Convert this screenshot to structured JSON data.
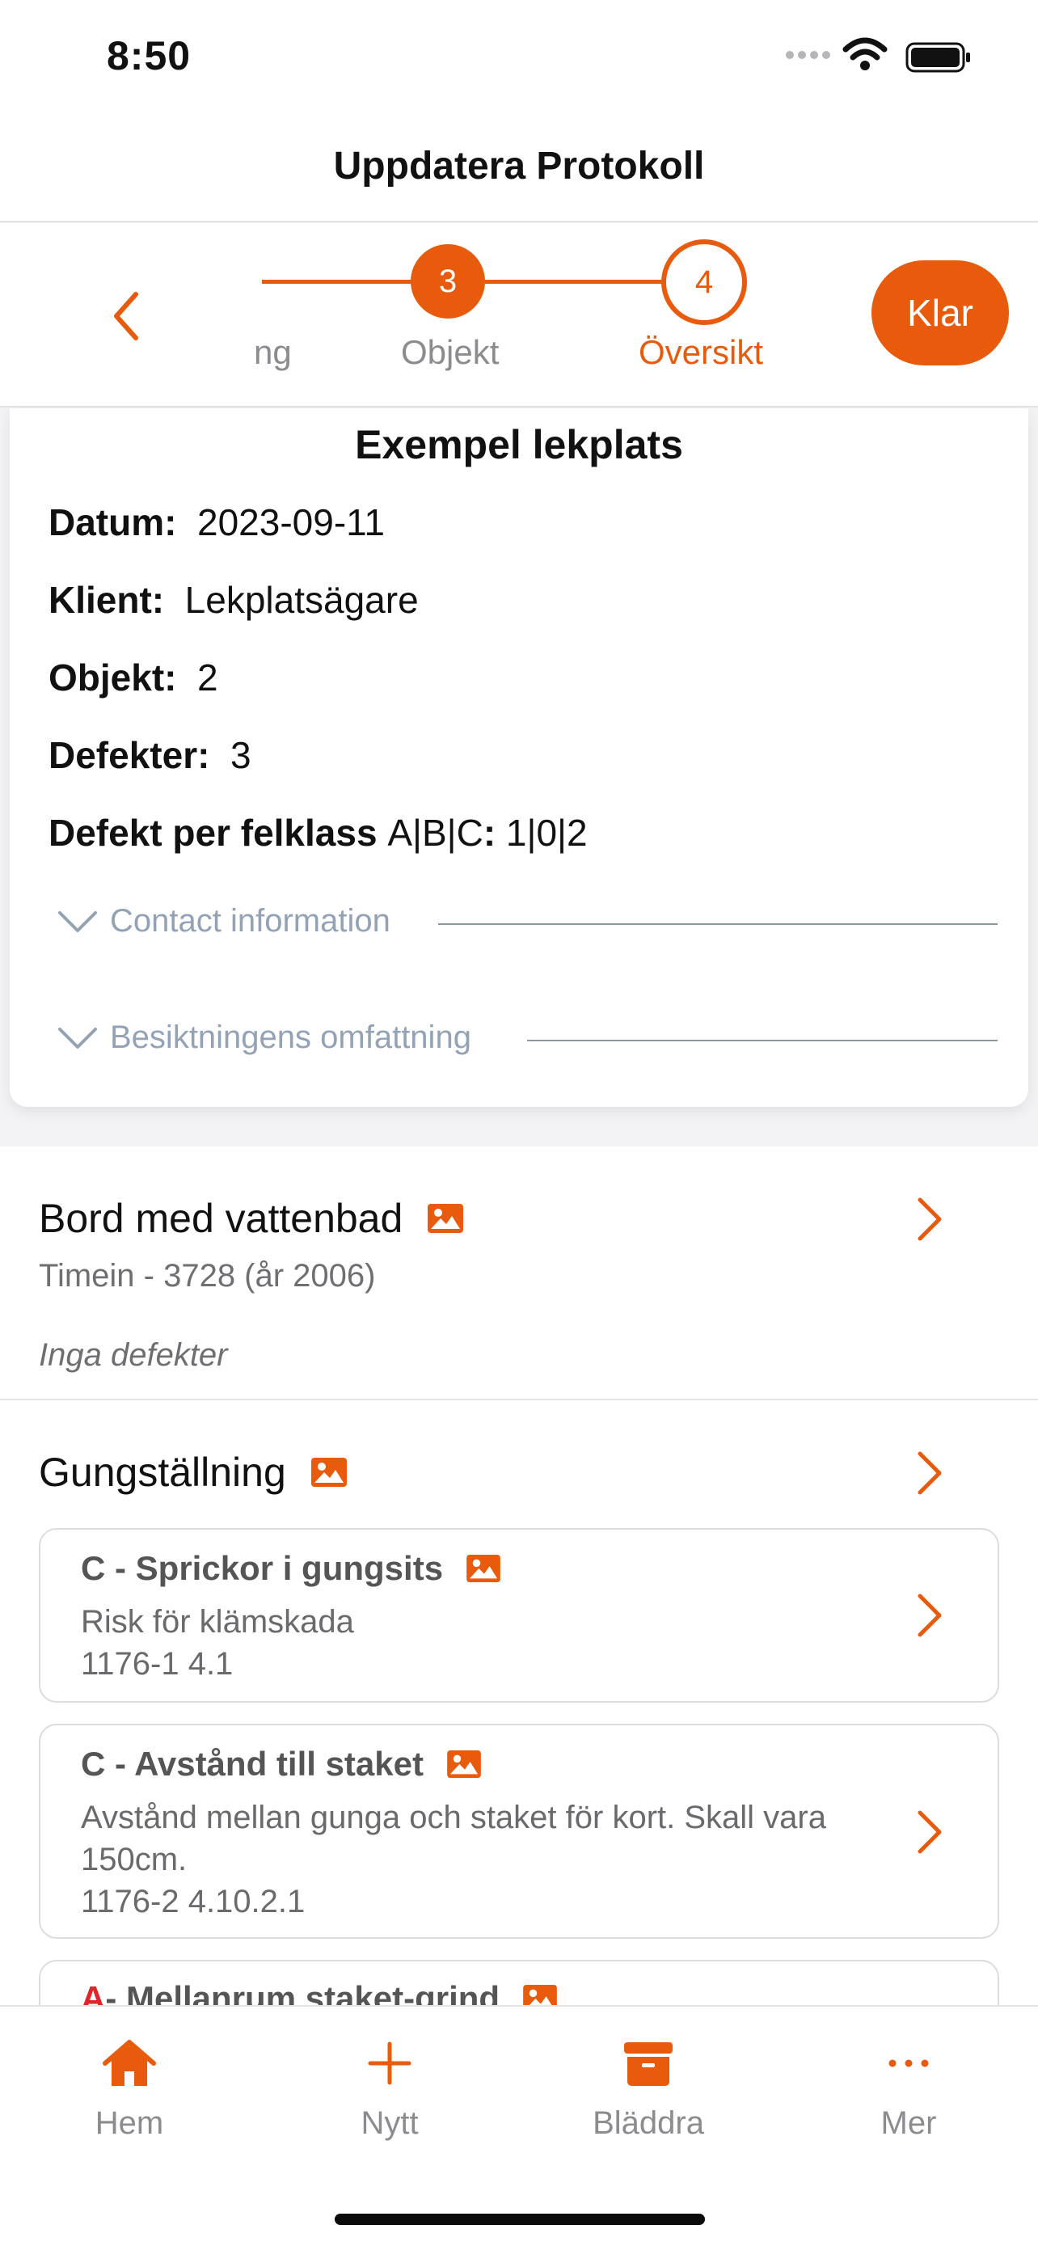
{
  "status_bar": {
    "time": "8:50"
  },
  "nav": {
    "title": "Uppdatera Protokoll"
  },
  "stepper": {
    "partial_label": "ng",
    "steps": [
      {
        "number": "3",
        "label": "Objekt",
        "state": "done"
      },
      {
        "number": "4",
        "label": "Översikt",
        "state": "active"
      }
    ],
    "done_button": "Klar"
  },
  "summary": {
    "title": "Exempel lekplats",
    "rows": [
      {
        "label": "Datum:",
        "value": "2023-09-11"
      },
      {
        "label": "Klient:",
        "value": "Lekplatsägare"
      },
      {
        "label": "Objekt:",
        "value": "2"
      },
      {
        "label": "Defekter:",
        "value": "3"
      },
      {
        "label": "Defekt per felklass",
        "mid": "A|B|C",
        "colon": ":",
        "value": "1|0|2"
      }
    ],
    "sections": [
      "Contact information",
      "Besiktningens omfattning"
    ]
  },
  "objects": [
    {
      "title": "Bord med vattenbad",
      "subtitle": "Timein - 3728 (år 2006)",
      "note": "Inga defekter"
    },
    {
      "title": "Gungställning",
      "defects": [
        {
          "title": "C - Sprickor i gungsits",
          "lines": [
            "Risk för klämskada",
            "1176-1 4.1"
          ]
        },
        {
          "title": "C - Avstånd till staket",
          "lines": [
            "Avstånd mellan gunga och staket för kort. Skall vara 150cm.",
            "1176-2 4.10.2.1"
          ]
        },
        {
          "title_prefix": "A",
          "title_rest": " - Mellanrum staket-grind"
        }
      ]
    }
  ],
  "tabs": [
    {
      "label": "Hem",
      "icon": "home-icon"
    },
    {
      "label": "Nytt",
      "icon": "plus-icon"
    },
    {
      "label": "Bläddra",
      "icon": "archive-icon"
    },
    {
      "label": "Mer",
      "icon": "more-icon"
    }
  ],
  "colors": {
    "accent": "#e85a0c",
    "muted": "#8b8b90",
    "severity_a": "#e0262a"
  }
}
